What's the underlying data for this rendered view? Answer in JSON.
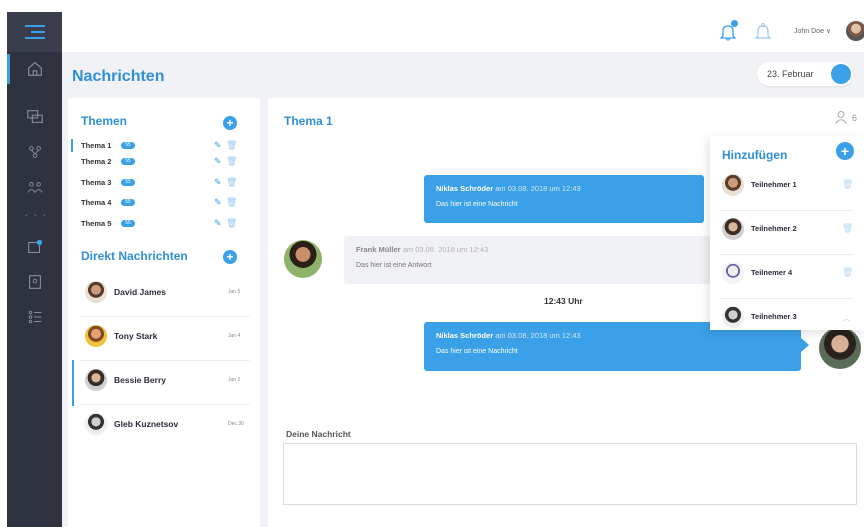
{
  "topbar": {
    "user_name": "John Doe ∨"
  },
  "page": {
    "title": "Nachrichten",
    "date": "23. Februar"
  },
  "topics": {
    "heading": "Themen",
    "items": [
      {
        "label": "Thema 1",
        "badge": "55"
      },
      {
        "label": "Thema 2",
        "badge": "55"
      },
      {
        "label": "Thema 3",
        "badge": "55"
      },
      {
        "label": "Thema 4",
        "badge": "55"
      },
      {
        "label": "Thema 5",
        "badge": "55"
      }
    ]
  },
  "direct": {
    "heading": "Direkt Nachrichten",
    "items": [
      {
        "name": "David James",
        "date": "Jan 5"
      },
      {
        "name": "Tony Stark",
        "date": "Jan 4"
      },
      {
        "name": "Bessie Berry",
        "date": "Jan 2"
      },
      {
        "name": "Gleb Kuznetsov",
        "date": "Dec 30"
      }
    ]
  },
  "chat": {
    "title": "Thema 1",
    "participant_count": "6",
    "messages": [
      {
        "author": "Niklas Schröder",
        "meta": "am 03.08. 2018 um 12:43",
        "text": "Das hier ist eine Nachricht"
      },
      {
        "author": "Frank Müller",
        "meta": "am 03.08. 2018 um 12:43",
        "text": "Das hier ist eine Antwort"
      },
      {
        "author": "Niklas Schröder",
        "meta": "am 03.08. 2018 um 12:43",
        "text": "Das hier ist eine Nachricht"
      }
    ],
    "time_label": "12:43 Uhr",
    "input_label": "Deine Nachricht"
  },
  "popover": {
    "title": "Hinzufügen",
    "items": [
      {
        "name": "Teilnehmer 1"
      },
      {
        "name": "Teilnehmer 2"
      },
      {
        "name": "Teilnemer 4"
      },
      {
        "name": "Teilnehmer 3"
      }
    ]
  },
  "colors": {
    "accent": "#3aa0e8",
    "sidebar": "#2f323f",
    "background": "#f1f2f5"
  }
}
